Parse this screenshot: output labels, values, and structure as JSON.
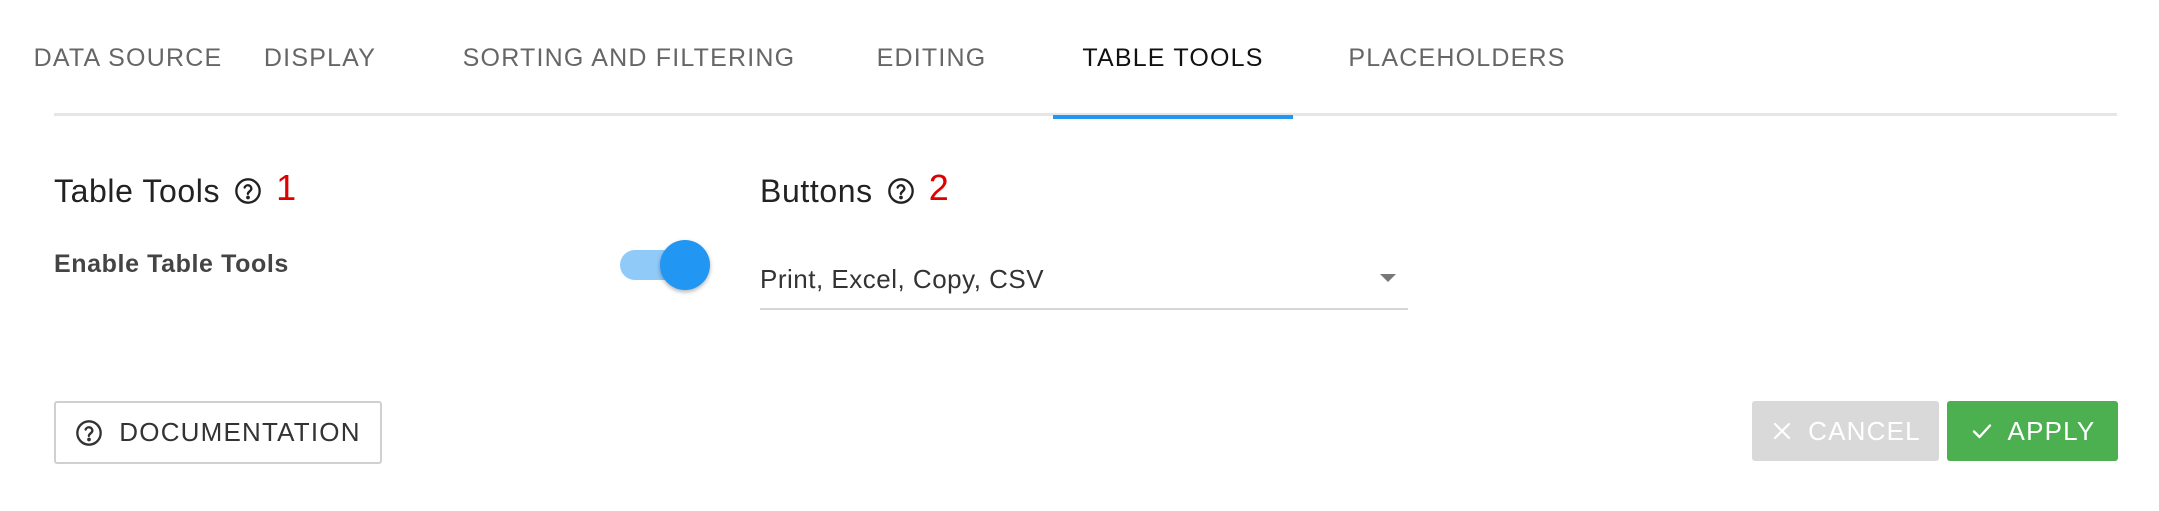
{
  "tabs": [
    {
      "label": "DATA SOURCE"
    },
    {
      "label": "DISPLAY"
    },
    {
      "label": "SORTING AND FILTERING"
    },
    {
      "label": "EDITING"
    },
    {
      "label": "TABLE TOOLS",
      "active": true
    },
    {
      "label": "PLACEHOLDERS"
    }
  ],
  "table_tools": {
    "title": "Table Tools",
    "marker": "1",
    "enable_label": "Enable Table Tools",
    "enabled": true
  },
  "buttons_section": {
    "title": "Buttons",
    "marker": "2",
    "selected_value": "Print, Excel, Copy, CSV"
  },
  "footer": {
    "documentation_label": "DOCUMENTATION",
    "cancel_label": "CANCEL",
    "apply_label": "APPLY"
  },
  "colors": {
    "accent": "#2196f3",
    "apply": "#4caf50",
    "cancel_disabled": "#d9d9d9",
    "marker": "#e00000"
  },
  "icons": {
    "help": "help-circle-icon",
    "cancel": "close-icon",
    "apply": "check-icon",
    "select_caret": "caret-down-icon"
  }
}
